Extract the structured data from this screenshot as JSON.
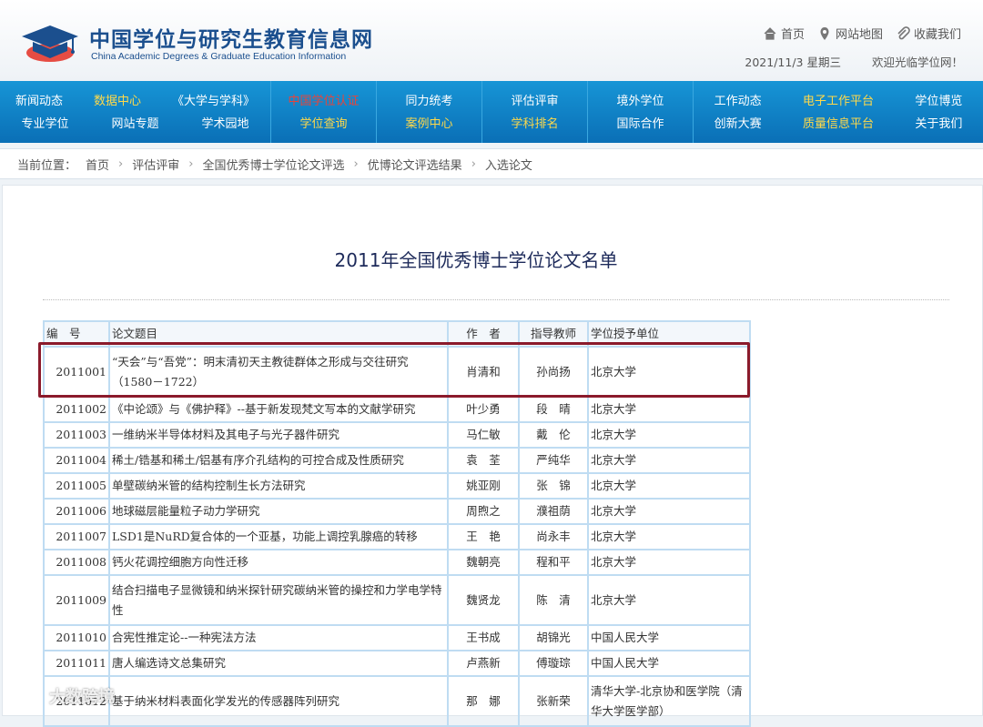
{
  "header": {
    "title_cn": "中国学位与研究生教育信息网",
    "title_en": "China Academic Degrees & Graduate Education Information",
    "links": {
      "home": "首页",
      "sitemap": "网站地图",
      "favorite": "收藏我们"
    },
    "date": "2021/11/3 星期三",
    "welcome": "欢迎光临学位网！"
  },
  "nav": {
    "groups": [
      {
        "top": [
          "新闻动态",
          "数据中心",
          "《大学与学科》"
        ],
        "bottom": [
          "专业学位",
          "网站专题",
          "学术园地"
        ]
      },
      {
        "top": [
          "中国学位认证"
        ],
        "bottom": [
          "学位查询"
        ]
      },
      {
        "top": [
          "同力统考"
        ],
        "bottom": [
          "案例中心"
        ]
      },
      {
        "top": [
          "评估评审"
        ],
        "bottom": [
          "学科排名"
        ]
      },
      {
        "top": [
          "境外学位"
        ],
        "bottom": [
          "国际合作"
        ]
      },
      {
        "top": [
          "工作动态",
          "电子工作平台",
          "学位博览"
        ],
        "bottom": [
          "创新大赛",
          "质量信息平台",
          "关于我们"
        ]
      }
    ],
    "colors": {
      "yellow": "#ffd94a",
      "red": "#e8443a",
      "bar": "#0a6fb6"
    }
  },
  "breadcrumb": {
    "label": "当前位置：",
    "items": [
      "首页",
      "评估评审",
      "全国优秀博士学位论文评选",
      "优博论文评选结果",
      "入选论文"
    ]
  },
  "page": {
    "title": "2011年全国优秀博士学位论文名单"
  },
  "table": {
    "headers": [
      "编　号",
      "论文题目",
      "作　者",
      "指导教师",
      "学位授予单位"
    ],
    "rows": [
      [
        "2011001",
        "“天会”与“吾党”：明末清初天主教徒群体之形成与交往研究（1580－1722）",
        "肖清和",
        "孙尚扬",
        "北京大学"
      ],
      [
        "2011002",
        "《中论颂》与《佛护释》--基于新发现梵文写本的文献学研究",
        "叶少勇",
        "段　晴",
        "北京大学"
      ],
      [
        "2011003",
        "一维纳米半导体材料及其电子与光子器件研究",
        "马仁敏",
        "戴　伦",
        "北京大学"
      ],
      [
        "2011004",
        "稀土/锆基和稀土/铝基有序介孔结构的可控合成及性质研究",
        "袁　荃",
        "严纯华",
        "北京大学"
      ],
      [
        "2011005",
        "单壁碳纳米管的结构控制生长方法研究",
        "姚亚刚",
        "张　锦",
        "北京大学"
      ],
      [
        "2011006",
        "地球磁层能量粒子动力学研究",
        "周煦之",
        "濮祖荫",
        "北京大学"
      ],
      [
        "2011007",
        "LSD1是NuRD复合体的一个亚基，功能上调控乳腺癌的转移",
        "王　艳",
        "尚永丰",
        "北京大学"
      ],
      [
        "2011008",
        "钙火花调控细胞方向性迁移",
        "魏朝亮",
        "程和平",
        "北京大学"
      ],
      [
        "2011009",
        "结合扫描电子显微镜和纳米探针研究碳纳米管的操控和力学电学特性",
        "魏贤龙",
        "陈　清",
        "北京大学"
      ],
      [
        "2011010",
        "合宪性推定论--一种宪法方法",
        "王书成",
        "胡锦光",
        "中国人民大学"
      ],
      [
        "2011011",
        "唐人编选诗文总集研究",
        "卢燕新",
        "傅璇琮",
        "中国人民大学"
      ],
      [
        "2011012",
        "基于纳米材料表面化学发光的传感器阵列研究",
        "那　娜",
        "张新荣",
        "清华大学-北京协和医学院（清华大学医学部）"
      ]
    ]
  },
  "watermark": "大数跨境"
}
